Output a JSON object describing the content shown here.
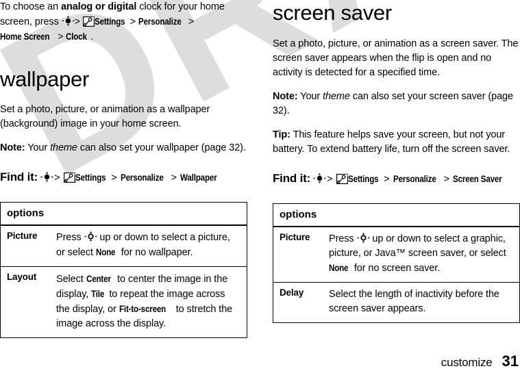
{
  "watermark": {
    "text": "DRAFT"
  },
  "left_column": {
    "intro": {
      "before_bold": "To choose an ",
      "bold": "analog or digital",
      "after_bold": " clock for your home screen, press ",
      "nav_icon": "navigation-key-icon",
      "sep1": ">",
      "settings_icon": "settings-tools-icon",
      "crumb1": "Settings",
      "sep2": ">",
      "crumb2": "Personalize",
      "sep3": ">",
      "crumb3": "Home Screen",
      "sep4": ">",
      "crumb4": "Clock",
      "period": "."
    },
    "heading": "wallpaper",
    "paragraph": "Set a photo, picture, or animation as a wallpaper (background) image in your home screen.",
    "note": {
      "label": "Note:",
      "before_italic": " Your ",
      "italic": "theme",
      "after_italic": " can also set your wallpaper (page 32)."
    },
    "find_it": {
      "label": "Find it:",
      "nav_icon": "navigation-key-icon",
      "sep1": ">",
      "settings_icon": "settings-tools-icon",
      "crumb1": "Settings",
      "sep2": ">",
      "crumb2": "Personalize",
      "sep3": ">",
      "crumb3": "Wallpaper"
    },
    "table": {
      "header": "options",
      "rows": [
        {
          "name": "Picture",
          "desc_part1": "Press ",
          "nav_icon": "navigation-key-open-icon",
          "desc_part2": " up or down to select a picture, or select ",
          "ui_term": "None",
          "desc_part3": " for no wallpaper."
        },
        {
          "name": "Layout",
          "desc_part1": "Select ",
          "ui_term1": "Center",
          "desc_part2": " to center the image in the display, ",
          "ui_term2": "Tile",
          "desc_part3": " to repeat the image across the display, or ",
          "ui_term3": "Fit-to-screen",
          "desc_part4": " to stretch the image across the display."
        }
      ]
    }
  },
  "right_column": {
    "heading": "screen saver",
    "paragraph": "Set a photo, picture, or animation as a screen saver. The screen saver appears when the flip is open and no activity is detected for a specified time.",
    "note": {
      "label": "Note:",
      "before_italic": " Your ",
      "italic": "theme",
      "after_italic": " can also set your screen saver (page 32)."
    },
    "tip": {
      "label": "Tip:",
      "text": " This feature helps save your screen, but not your battery. To extend battery life, turn off the screen saver."
    },
    "find_it": {
      "label": "Find it:",
      "nav_icon": "navigation-key-icon",
      "sep1": ">",
      "settings_icon": "settings-tools-icon",
      "crumb1": "Settings",
      "sep2": ">",
      "crumb2": "Personalize",
      "sep3": ">",
      "crumb3": "Screen Saver"
    },
    "table": {
      "header": "options",
      "rows": [
        {
          "name": "Picture",
          "desc_part1": "Press ",
          "nav_icon": "navigation-key-open-icon",
          "desc_part2": " up or down to select a graphic, picture, or Java™ screen saver, or select ",
          "ui_term": "None",
          "desc_part3": " for no screen saver."
        },
        {
          "name": "Delay",
          "desc_part1": "Select the length of inactivity before the screen saver appears."
        }
      ]
    }
  },
  "footer": {
    "chapter": "customize",
    "page_number": "31"
  }
}
